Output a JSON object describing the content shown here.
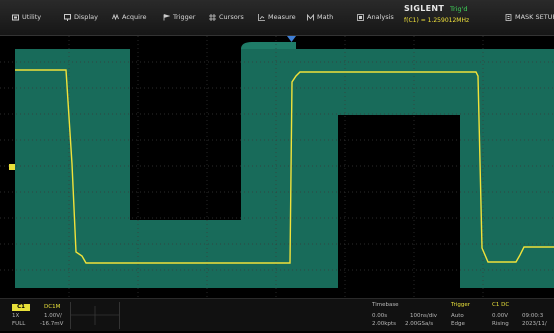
{
  "menu": {
    "items": [
      {
        "label": "Utility",
        "icon": "utility-icon"
      },
      {
        "label": "Display",
        "icon": "display-icon"
      },
      {
        "label": "Acquire",
        "icon": "acquire-icon"
      },
      {
        "label": "Trigger",
        "icon": "trigger-icon"
      },
      {
        "label": "Cursors",
        "icon": "cursors-icon"
      },
      {
        "label": "Measure",
        "icon": "measure-icon"
      },
      {
        "label": "Math",
        "icon": "math-icon"
      },
      {
        "label": "Analysis",
        "icon": "analysis-icon"
      },
      {
        "label": "MASK SETUP",
        "icon": "mask-icon"
      }
    ]
  },
  "brand": {
    "name": "SIGLENT",
    "trigger_state": "Trig'd",
    "freq": "f(C1) = 1.259012MHz"
  },
  "colors": {
    "trace": "#f0e23a",
    "persistence": "#186b5a",
    "grid": "#3a3a3a",
    "trigger_marker": "#3f7fd6"
  },
  "status": {
    "ch1": {
      "label": "C1",
      "coupling": "DC1M",
      "probe": "1X",
      "scale": "1.00V/",
      "bw": "FULL",
      "offset": "-16.7mV"
    },
    "timebase": {
      "title": "Timebase",
      "delay": "0.00s",
      "scale": "100ns/div",
      "sample_len": "2.00kpts",
      "sample_rate": "2.00GSa/s"
    },
    "trigger": {
      "title": "Trigger",
      "source": "C1 DC",
      "mode": "Auto",
      "level": "0.00V",
      "type": "Edge",
      "slope": "Rising"
    },
    "clock": {
      "time": "09:00:3",
      "date": "2023/11/"
    }
  }
}
